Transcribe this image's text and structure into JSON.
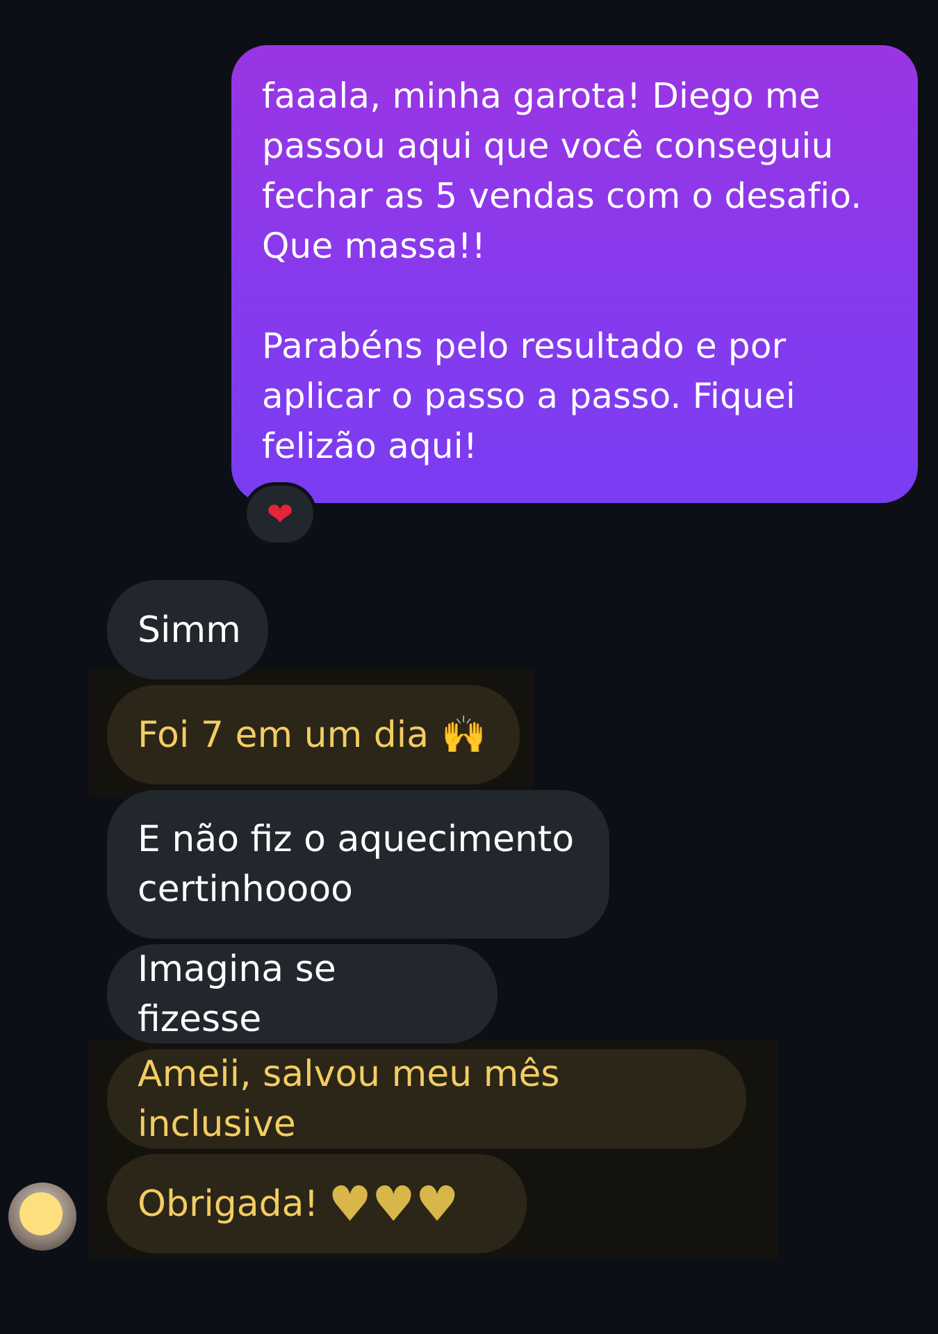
{
  "conversation": {
    "sent_message": {
      "text": "faaala, minha garota! Diego me\npassou aqui que você conseguiu\nfechar as 5 vendas com o desafio.\nQue massa!!\n\nParabéns pelo resultado e por\naplicar o passo a passo. Fiquei\nfelizão aqui!",
      "reaction": "❤"
    },
    "received_messages": [
      {
        "text": "Simm"
      },
      {
        "text": "Foi 7 em um dia",
        "emoji": "🙌"
      },
      {
        "text": "E não fiz o aquecimento\ncertinhoooo"
      },
      {
        "text": "Imagina se fizesse"
      },
      {
        "text": "Ameii, salvou meu mês inclusive"
      },
      {
        "text": "Obrigada!",
        "hearts": "♥♥♥"
      }
    ]
  },
  "colors": {
    "background": "#0c1016",
    "sent_gradient_top": "#9a35e3",
    "sent_gradient_bottom": "#7a3df2",
    "received_bubble": "#22262d",
    "highlighted_bubble": "#2b2618",
    "highlighted_text": "#f3cd63"
  }
}
